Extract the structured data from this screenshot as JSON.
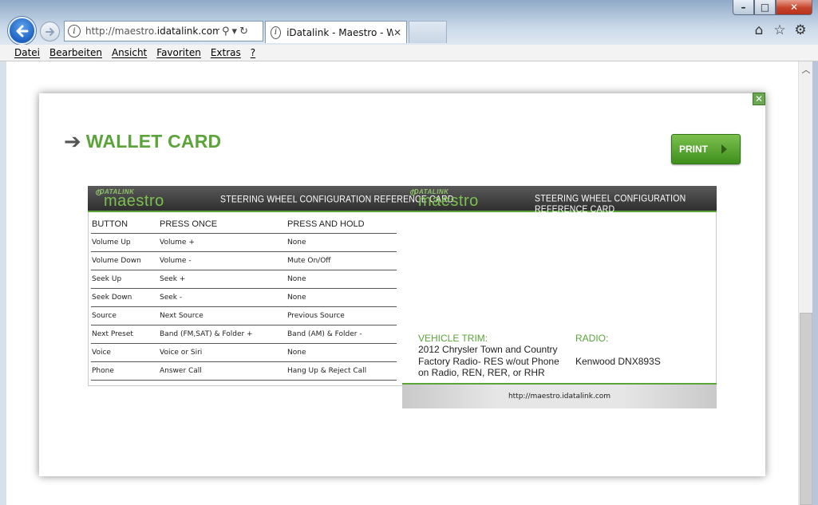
{
  "browser": {
    "address_url_prefix": "http://maestro.",
    "address_url_domain": "idatalink.com",
    "address_url_rest": "/w",
    "tab_title": "iDatalink - Maestro - Webli...",
    "menu": [
      "Datei",
      "Bearbeiten",
      "Ansicht",
      "Favoriten",
      "Extras",
      "?"
    ]
  },
  "page": {
    "heading": "WALLET CARD",
    "print_label": "PRINT"
  },
  "card": {
    "logo_small": "iDATALINK",
    "logo_big": "maestro",
    "bar_title": "STEERING WHEEL CONFIGURATION REFERENCE CARD",
    "columns": [
      "BUTTON",
      "PRESS ONCE",
      "PRESS AND HOLD"
    ],
    "rows": [
      [
        "Volume Up",
        "Volume +",
        "None"
      ],
      [
        "Volume Down",
        "Volume -",
        "Mute On/Off"
      ],
      [
        "Seek Up",
        "Seek +",
        "None"
      ],
      [
        "Seek Down",
        "Seek -",
        "None"
      ],
      [
        "Source",
        "Next Source",
        "Previous Source"
      ],
      [
        "Next Preset",
        "Band (FM,SAT) & Folder +",
        "Band (AM) & Folder -"
      ],
      [
        "Voice",
        "Voice or Siri",
        "None"
      ],
      [
        "Phone",
        "Answer Call",
        "Hang Up & Reject Call"
      ]
    ],
    "vehicle_trim_label": "VEHICLE TRIM:",
    "vehicle_trim_value": "2012 Chrysler Town and Country Factory Radio- RES w/out Phone on Radio, REN, RER, or RHR",
    "radio_label": "RADIO:",
    "radio_value": "Kenwood DNX893S",
    "footer_url": "http://maestro.idatalink.com"
  },
  "colors": {
    "accent_green": "#5aa43a",
    "bar_dark": "#3a3a3a"
  }
}
